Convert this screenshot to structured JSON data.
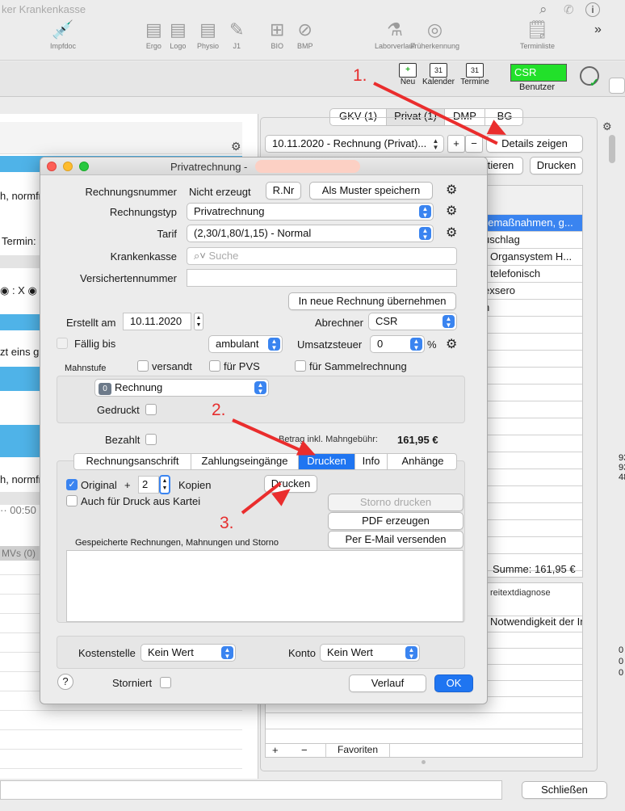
{
  "app": {
    "title": "ker Krankenkasse"
  },
  "toolbar": {
    "items": [
      {
        "label": "Impfdoc",
        "icon": "syringe-icon",
        "glyph": "💉"
      },
      {
        "label": "Ergo",
        "icon": "form-icon",
        "glyph": "▤"
      },
      {
        "label": "Logo",
        "icon": "form-icon",
        "glyph": "▤"
      },
      {
        "label": "Physio",
        "icon": "form-icon",
        "glyph": "▤"
      },
      {
        "label": "J1",
        "icon": "edit-icon",
        "glyph": "✎"
      },
      {
        "label": "BIO",
        "icon": "bio-icon",
        "glyph": "⊞"
      },
      {
        "label": "BMP",
        "icon": "pill-icon",
        "glyph": "⊘"
      },
      {
        "label": "Laborverlauf",
        "icon": "flask-icon",
        "glyph": "⚗"
      },
      {
        "label": "Früherkennung",
        "icon": "target-icon",
        "glyph": "◎"
      },
      {
        "label": "Terminliste",
        "icon": "list-icon",
        "glyph": "🗒"
      }
    ],
    "more": "»"
  },
  "secondbar": {
    "neu": "Neu",
    "kalender": "Kalender",
    "termine": "Termine",
    "cal_num": "31",
    "csr": "CSR",
    "benutzer": "Benutzer"
  },
  "right_panel": {
    "tabs": [
      "GKV (1)",
      "Privat (1)",
      "DMP",
      "BG"
    ],
    "invoice_select": "10.11.2020 - Rechnung (Privat)...",
    "plus": "+",
    "minus": "−",
    "details_button": "Details zeigen",
    "tieren_button": "tieren",
    "drucken_button": "Drucken",
    "rows": [
      "hemaßnahmen, g...",
      "uschlag",
      "Organsystem H...",
      "telefonisch",
      "exsero",
      "n"
    ],
    "summe": "Summe: 161,95 €",
    "sub_header": "reitextdiagnose",
    "sub_row": "Notwendigkeit der In",
    "favoriten": "Favoriten",
    "side_nums": [
      "93",
      "93",
      "48",
      "0",
      "0",
      "0"
    ]
  },
  "left_panel": {
    "texts": [
      "h, normfr",
      "Termin:",
      "◉ : X ◉",
      "zt eins g",
      "h, normfr",
      "·· 00:50",
      "MVs (0)"
    ]
  },
  "dialog": {
    "title": "Privatrechnung -",
    "rechnungsnummer_label": "Rechnungsnummer",
    "rechnungsnummer_value": "Nicht erzeugt",
    "rnr_button": "R.Nr",
    "muster_button": "Als Muster speichern",
    "rechnungstyp_label": "Rechnungstyp",
    "rechnungstyp_value": "Privatrechnung",
    "tarif_label": "Tarif",
    "tarif_value": "(2,30/1,80/1,15) - Normal",
    "krankenkasse_label": "Krankenkasse",
    "search_placeholder": "Suche",
    "versichertennummer_label": "Versichertennummer",
    "versichertennummer_value": "",
    "neue_rechnung_button": "In neue Rechnung übernehmen",
    "erstellt_label": "Erstellt am",
    "erstellt_value": "10.11.2020",
    "abrechner_label": "Abrechner",
    "abrechner_value": "CSR",
    "faellig_label": "Fällig bis",
    "ambulant_value": "ambulant",
    "umsatzsteuer_label": "Umsatzsteuer",
    "umsatzsteuer_value": "0",
    "percent": "%",
    "mahnstufe_label": "Mahnstufe",
    "versandt_label": "versandt",
    "fuer_pvs_label": "für PVS",
    "sammelrechnung_label": "für Sammelrechnung",
    "mahn_badge": "0",
    "mahn_value": "Rechnung",
    "gedruckt_label": "Gedruckt",
    "bezahlt_label": "Bezahlt",
    "betrag_label": "Betrag inkl. Mahngebühr:",
    "betrag_value": "161,95 €",
    "tabs": [
      "Rechnungsanschrift",
      "Zahlungseingänge",
      "Drucken",
      "Info",
      "Anhänge"
    ],
    "original_label": "Original",
    "plus_sign": "+",
    "kopien_value": "2",
    "kopien_label": "Kopien",
    "drucken_button": "Drucken",
    "auch_label": "Auch für Druck aus Kartei",
    "storno_button": "Storno drucken",
    "pdf_button": "PDF erzeugen",
    "email_button": "Per E-Mail versenden",
    "gespeicherte_label": "Gespeicherte Rechnungen, Mahnungen und Storno",
    "kostenstelle_label": "Kostenstelle",
    "kostenstelle_value": "Kein Wert",
    "konto_label": "Konto",
    "konto_value": "Kein Wert",
    "help": "?",
    "storniert_label": "Storniert",
    "verlauf_button": "Verlauf",
    "ok_button": "OK"
  },
  "annotations": {
    "step1": "1.",
    "step2": "2.",
    "step3": "3."
  },
  "bottom": {
    "schliessen": "Schließen"
  },
  "colors": {
    "accent": "#3a84f0",
    "csr_green": "#22e02a",
    "arrow_red": "#ea2d2d"
  }
}
